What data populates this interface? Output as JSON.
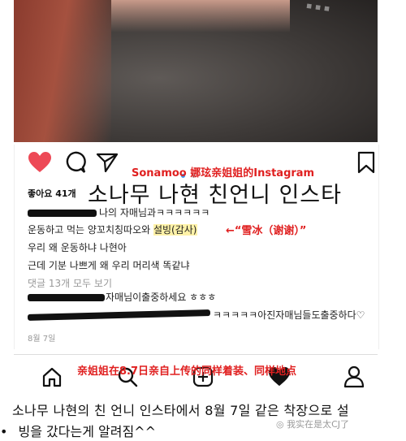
{
  "post": {
    "likes": "좋아요 41개",
    "overlay_caption": "Sonamoo 娜玹亲姐姐的Instagram",
    "title": "소나무 나현 친언니 인스타",
    "comment1": "나의 자매님과ㅋㅋㅋㅋㅋㅋ",
    "comment2_a": "운동하고 먹는 양꼬치칭따오와 ",
    "comment2_b": "설빙(감사)",
    "note": "←“雪冰（谢谢）”",
    "comment3": "우리 왜 운동하냐 나현아",
    "comment4": "근데 기분 나쁘게 왜 우리 머리색 똑같냐",
    "see_all": "댓글 13개 모두 보기",
    "comment5": "자매님이출중하세요 ㅎㅎㅎ",
    "comment6": "ㅋㅋㅋㅋㅋ아진자매님들도출중하다♡",
    "date": "8월 7일"
  },
  "bottom_caption": "亲姐姐在8.7日亲自上传的同样着装、同样地点",
  "footer": {
    "line1": "소나무 나현의 친 언니 인스타에서 8월 7일 같은 착장으로 설",
    "line2": "빙을 갔다는게 알려짐^^",
    "bullet": "•",
    "watermark": "我实在是太CJ了"
  },
  "colors": {
    "heart": "#ed4956",
    "annotation": "#e02020"
  }
}
